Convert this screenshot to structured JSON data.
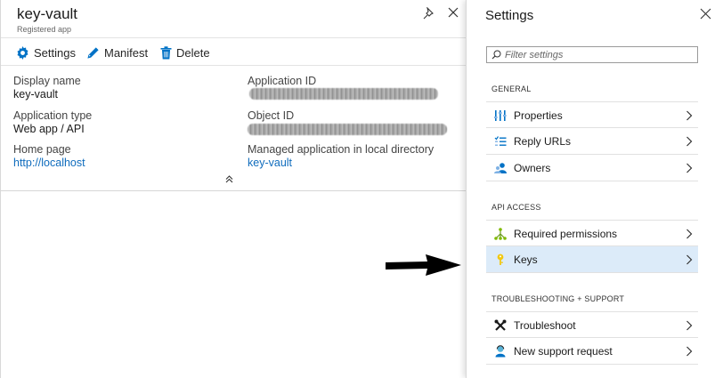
{
  "app": {
    "title": "key-vault",
    "subtitle": "Registered app"
  },
  "toolbar": {
    "settings_label": "Settings",
    "manifest_label": "Manifest",
    "delete_label": "Delete"
  },
  "essentials": {
    "display_name_label": "Display name",
    "display_name_value": "key-vault",
    "app_type_label": "Application type",
    "app_type_value": "Web app / API",
    "home_page_label": "Home page",
    "home_page_value": "http://localhost",
    "app_id_label": "Application ID",
    "object_id_label": "Object ID",
    "managed_app_label": "Managed application in local directory",
    "managed_app_value": "key-vault",
    "collapse_glyph": "«"
  },
  "settings_blade": {
    "title": "Settings",
    "filter_placeholder": "Filter settings",
    "sections": [
      {
        "heading": "GENERAL",
        "items": [
          {
            "label": "Properties",
            "icon": "properties-icon"
          },
          {
            "label": "Reply URLs",
            "icon": "reply-urls-icon"
          },
          {
            "label": "Owners",
            "icon": "owners-icon"
          }
        ]
      },
      {
        "heading": "API ACCESS",
        "items": [
          {
            "label": "Required permissions",
            "icon": "permissions-icon"
          },
          {
            "label": "Keys",
            "icon": "key-icon",
            "selected": true
          }
        ]
      },
      {
        "heading": "TROUBLESHOOTING + SUPPORT",
        "items": [
          {
            "label": "Troubleshoot",
            "icon": "troubleshoot-icon"
          },
          {
            "label": "New support request",
            "icon": "support-request-icon"
          }
        ]
      }
    ]
  },
  "colors": {
    "link": "#0f6cbd",
    "selected_row": "#dcebf9",
    "icon_blue": "#0072c6"
  }
}
